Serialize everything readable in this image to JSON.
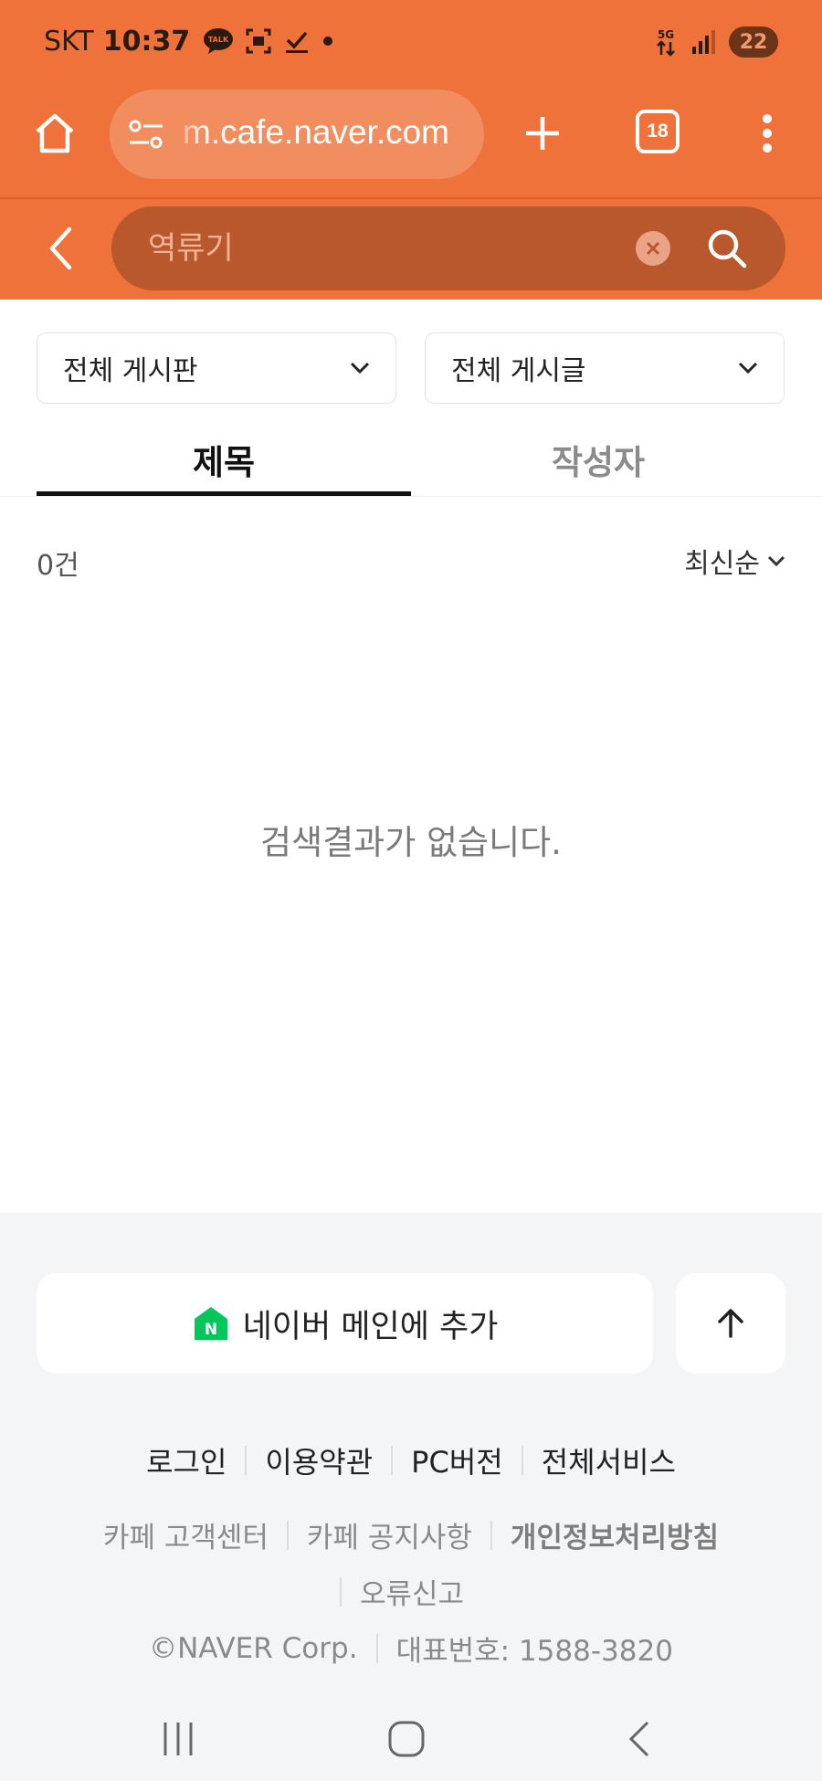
{
  "status_bar": {
    "carrier": "SKT",
    "time": "10:37",
    "talk_badge": "TALK",
    "network": "5G",
    "battery": "22"
  },
  "browser": {
    "url": "m.cafe.naver.com",
    "tab_count": "18"
  },
  "search": {
    "placeholder": "역류기"
  },
  "filters": {
    "board": "전체 게시판",
    "post": "전체 게시글"
  },
  "tabs": [
    {
      "label": "제목",
      "active": true
    },
    {
      "label": "작성자",
      "active": false
    }
  ],
  "results": {
    "count": "0건",
    "sort": "최신순",
    "empty_message": "검색결과가 없습니다."
  },
  "footer": {
    "add_to_main": "네이버 메인에 추가",
    "links": [
      "로그인",
      "이용약관",
      "PC버전",
      "전체서비스"
    ],
    "sub_links": [
      "카페 고객센터",
      "카페 공지사항",
      "개인정보처리방침"
    ],
    "report": "오류신고",
    "copyright": "©NAVER Corp.",
    "phone": "대표번호: 1588-3820"
  },
  "colors": {
    "brand_orange": "#ee723a",
    "naver_green": "#03c75a"
  },
  "icons": {
    "home": "home-icon",
    "site_settings": "site-settings-icon",
    "new_tab": "plus-icon",
    "menu": "more-vertical-icon",
    "back": "chevron-left-icon",
    "clear": "close-circle-icon",
    "search": "search-icon",
    "dropdown": "chevron-down-icon",
    "scroll_top": "arrow-up-icon"
  }
}
